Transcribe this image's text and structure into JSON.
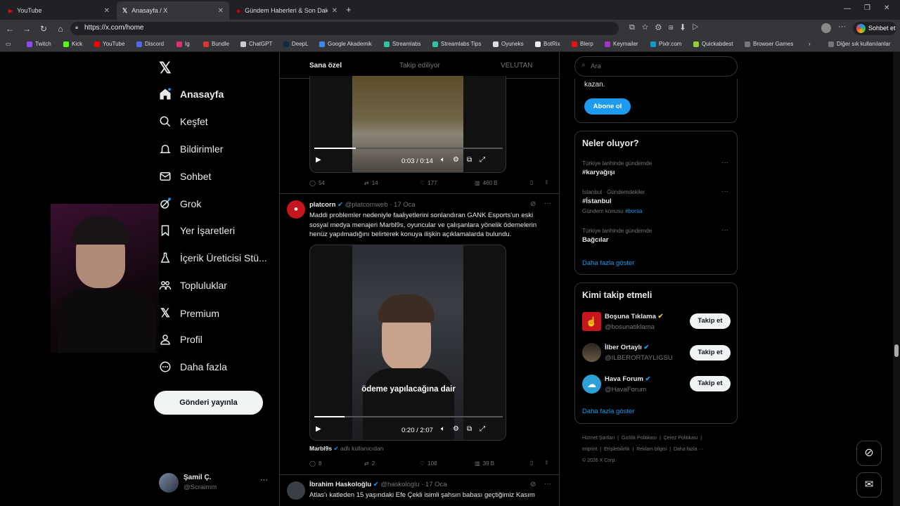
{
  "browser": {
    "tabs": [
      {
        "label": "YouTube"
      },
      {
        "label": "Anasayfa / X"
      },
      {
        "label": "Gündem Haberleri & Son Dakika H"
      }
    ],
    "url": "https://x.com/home",
    "sohbet": "Sohbet et",
    "bookmarks": [
      "Twitch",
      "Kick",
      "YouTube",
      "Discord",
      "Ig",
      "Bundle",
      "ChatGPT",
      "DeepL",
      "Google Akademik",
      "Streamlabs",
      "Streamlabs Tips",
      "Oyuneks",
      "BotRix",
      "Blerp",
      "Keymailer",
      "Pixlr.com",
      "Quickabdest",
      "Browser Games"
    ],
    "other_bookmarks": "Diğer sık kullanılanlar"
  },
  "nav": {
    "items": [
      "Anasayfa",
      "Keşfet",
      "Bildirimler",
      "Sohbet",
      "Grok",
      "Yer İşaretleri",
      "İçerik Üreticisi Stü...",
      "Topluluklar",
      "Premium",
      "Profil",
      "Daha fazla"
    ],
    "post_button": "Gönderi yayınla",
    "profile": {
      "name": "Şamil Ç.",
      "handle": "@Scraimm"
    }
  },
  "feed": {
    "tabs": [
      "Sana özel",
      "Takip ediliyor",
      "VELUTAN"
    ],
    "tweet1": {
      "time": "0:03 / 0:14",
      "stats": {
        "replies": "54",
        "retweets": "14",
        "likes": "177",
        "views": "460 B"
      }
    },
    "tweet2": {
      "name": "platcorn",
      "handle": "@platcornweb",
      "date": "· 17 Oca",
      "text": "Maddi problemler nedeniyle faaliyetlerini sonlandıran GANK Esports'un eski sosyal medya menajeri Marbl9s, oyuncular ve çalışanlara yönelik ödemelerin henüz yapılmadığını belirterek konuya ilişkin açıklamalarda bulundu.",
      "caption": "ödeme yapılacağına dair",
      "time": "0:20 / 2:07",
      "source_user": "Marbl9s",
      "source_suffix": "adlı kullanıcıdan",
      "stats": {
        "replies": "8",
        "retweets": "2",
        "likes": "108",
        "views": "39 B"
      },
      "progress": 0.16
    },
    "tweet3": {
      "name": "İbrahim Haskoloğlu",
      "handle": "@haskologlu",
      "date": "· 17 Oca",
      "text": "Atlas'ı katleden 15 yaşındaki Efe Çekli isimli şahsın babası geçtiğimiz Kasım"
    }
  },
  "right": {
    "search_placeholder": "Ara",
    "premium_text": "kazan.",
    "subscribe": "Abone ol",
    "trends_title": "Neler oluyor?",
    "trends": [
      {
        "context": "Türkiye tarihinde gündemde",
        "name": "#karyağışı",
        "extra": ""
      },
      {
        "context": "İstanbul · Gündemdekiler",
        "name": "#İstanbul",
        "extra_label": "Gündem konusu",
        "extra": "#borsa"
      },
      {
        "context": "Türkiye tarihinde gündemde",
        "name": "Bağcılar",
        "extra": ""
      }
    ],
    "show_more": "Daha fazla göster",
    "who_title": "Kimi takip etmeli",
    "who": [
      {
        "name": "Boşuna Tıklama",
        "handle": "@bosunatiklama"
      },
      {
        "name": "İlber Ortaylı",
        "handle": "@ILBERORTAYLIGSU"
      },
      {
        "name": "Hava Forum",
        "handle": "@HavaForum"
      }
    ],
    "follow": "Takip et",
    "show_more2": "Daha fazla göster",
    "footer": [
      "Hizmet Şartları",
      "Gizlilik Politikası",
      "Çerez Politikası",
      "Imprint",
      "Erişilebilirlik",
      "Reklam bilgisi",
      "Daha fazla ···",
      "© 2026 X Corp."
    ]
  },
  "colors": {
    "accent": "#1d9bf0",
    "bg": "#000000",
    "border": "#2f3336"
  }
}
